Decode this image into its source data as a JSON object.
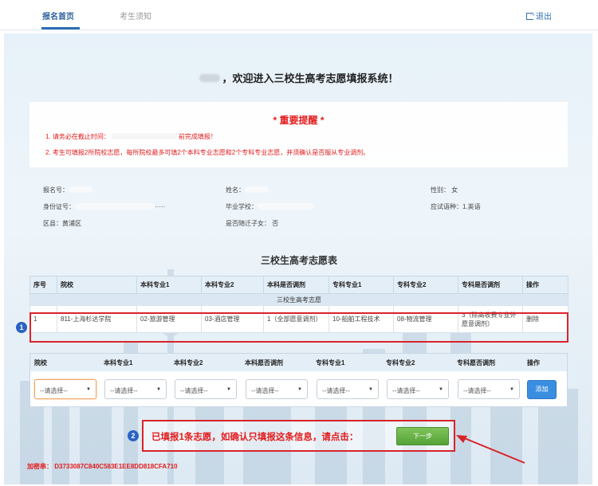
{
  "nav": {
    "tabs": [
      {
        "label": "报名首页",
        "active": true
      },
      {
        "label": "考生须知",
        "active": false
      }
    ],
    "logout_label": "退出"
  },
  "welcome": "，欢迎进入三校生高考志愿填报系统！",
  "notice": {
    "title": "* 重要提醒 *",
    "line1_prefix": "1. 请务必在截止时间：",
    "line1_suffix": "前完成填报！",
    "line2": "2. 考生可填报2所院校志愿，每所院校最多可填2个本科专业志愿和2个专科专业志愿，并须确认是否服从专业调剂。"
  },
  "info": {
    "reg_no_label": "报名号：",
    "name_label": "姓名：",
    "gender": "性别： 女",
    "id_label": "身份证号：",
    "id_tail": "·····",
    "school_label": "毕业学校：",
    "exam_lang": "应试语种：1.英语",
    "district": "区县：黄浦区",
    "migrant": "是否随迁子女： 否"
  },
  "table_title": "三校生高考志愿表",
  "main_table": {
    "headers": [
      "序号",
      "院校",
      "本科专业1",
      "本科专业2",
      "本科是否调剂",
      "专科专业1",
      "专科专业2",
      "专科是否调剂",
      "操作"
    ],
    "group_label": "三校生高考志愿",
    "rows": [
      [
        "1",
        "811-上海杉达学院",
        "02-旅游管理",
        "03-酒店管理",
        "1（全部愿意调剂）",
        "10-船舶工程技术",
        "08-物流管理",
        "3（除高收费专业外愿意调剂）",
        "删除"
      ]
    ]
  },
  "add_table": {
    "headers": [
      "院校",
      "本科专业1",
      "本科专业2",
      "本科愿否调剂",
      "专科专业1",
      "专科专业2",
      "专科愿否调剂",
      "操作"
    ],
    "select_placeholder": "--请选择--",
    "add_label": "添加"
  },
  "badges": [
    "1",
    "2"
  ],
  "confirm": {
    "text": "已填报1条志愿，如确认只填报这条信息，请点击：",
    "next_label": "下一步"
  },
  "verify_code": "加密串： D3733087C840C583E1EE8DD818CFA710",
  "colors": {
    "accent": "#2d6db5",
    "alert": "#e31b1b",
    "next": "#5aa83c"
  }
}
